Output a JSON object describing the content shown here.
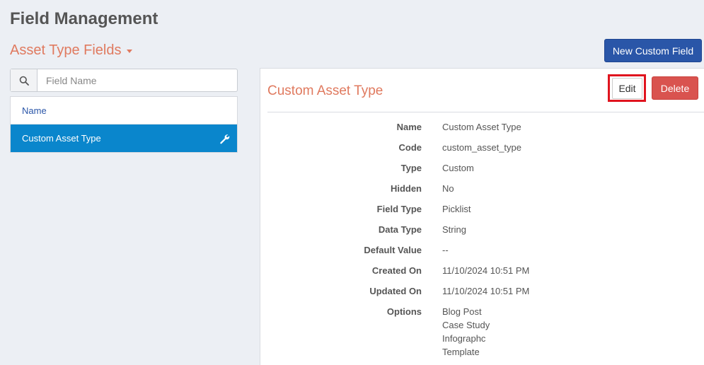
{
  "header": {
    "title": "Field Management",
    "section_dropdown": "Asset Type Fields",
    "new_button": "New Custom Field"
  },
  "search": {
    "placeholder": "Field Name",
    "value": ""
  },
  "list": {
    "header": "Name",
    "items": [
      {
        "label": "Custom Asset Type",
        "selected": true
      }
    ]
  },
  "detail": {
    "title": "Custom Asset Type",
    "edit_label": "Edit",
    "delete_label": "Delete",
    "fields": [
      {
        "label": "Name",
        "value": "Custom Asset Type"
      },
      {
        "label": "Code",
        "value": "custom_asset_type"
      },
      {
        "label": "Type",
        "value": "Custom"
      },
      {
        "label": "Hidden",
        "value": "No"
      },
      {
        "label": "Field Type",
        "value": "Picklist"
      },
      {
        "label": "Data Type",
        "value": "String"
      },
      {
        "label": "Default Value",
        "value": "--"
      },
      {
        "label": "Created On",
        "value": "11/10/2024 10:51 PM"
      },
      {
        "label": "Updated On",
        "value": "11/10/2024 10:51 PM"
      }
    ],
    "options_label": "Options",
    "options": [
      "Blog Post",
      "Case Study",
      "Infographc",
      "Template"
    ]
  },
  "colors": {
    "accent": "#e07a5f",
    "primary_button": "#2a56a8",
    "selected_row": "#0a86cc",
    "delete_button": "#d9534f",
    "highlight": "#e0141e"
  },
  "icons": {
    "search": "search-icon",
    "wrench": "wrench-icon",
    "caret": "caret-down-icon"
  }
}
